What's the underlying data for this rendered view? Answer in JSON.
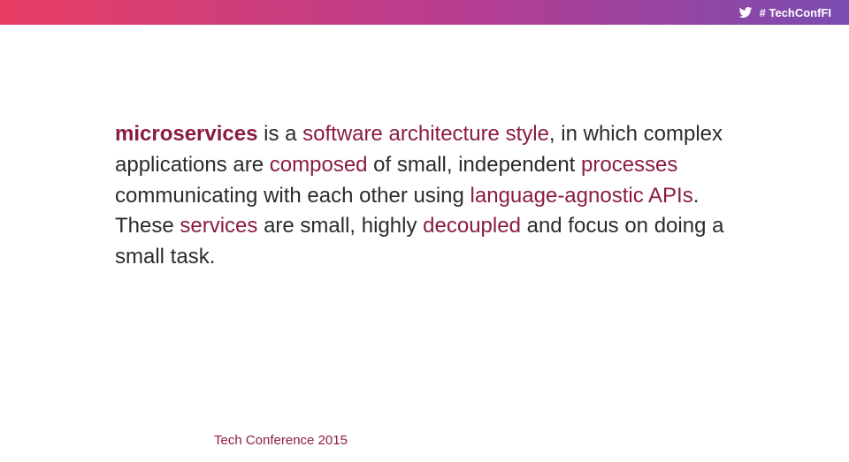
{
  "header": {
    "hashtag": "# TechConfFI"
  },
  "content": {
    "p1_hl_strong": "microservices",
    "p1_a": " is a ",
    "p1_hl1": "software architecture style",
    "p1_b": ", in which complex applications are ",
    "p1_hl2": "composed",
    "p1_c": " of small, independent ",
    "p1_hl3": "processes",
    "p1_d": " communicating with each other using ",
    "p1_hl4": "language-agnostic APIs",
    "p1_e": ".",
    "p2_a": "These ",
    "p2_hl1": "services",
    "p2_b": " are small, highly ",
    "p2_hl2": "decoupled",
    "p2_c": " and focus on doing a small task."
  },
  "footer": {
    "label": "Tech Conference 2015"
  }
}
